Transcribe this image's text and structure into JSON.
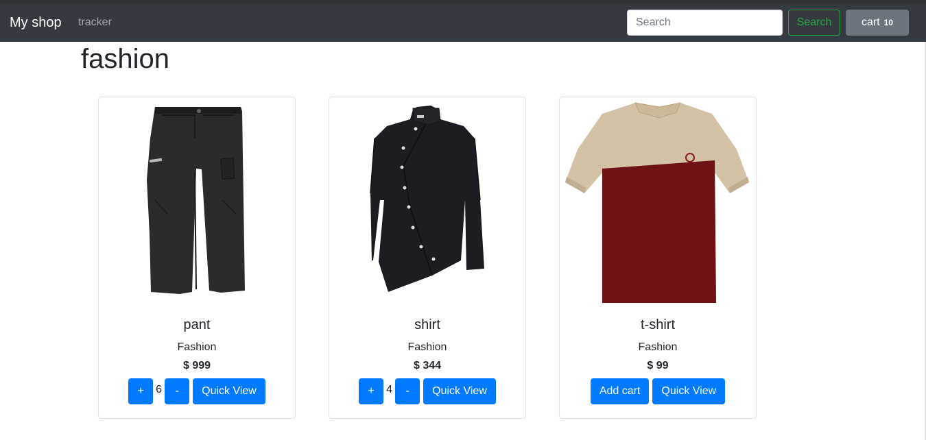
{
  "navbar": {
    "brand": "My shop",
    "link": "tracker",
    "search_placeholder": "Search",
    "search_button": "Search",
    "cart_label": "cart",
    "cart_count": "10"
  },
  "page_title": "fashion",
  "products": [
    {
      "name": "pant",
      "category": "Fashion",
      "price": "$ 999",
      "plus": "+",
      "qty": "6",
      "minus": "-",
      "quick_view": "Quick View",
      "image": "black-pants"
    },
    {
      "name": "shirt",
      "category": "Fashion",
      "price": "$ 344",
      "plus": "+",
      "qty": "4",
      "minus": "-",
      "quick_view": "Quick View",
      "image": "black-shirt"
    },
    {
      "name": "t-shirt",
      "category": "Fashion",
      "price": "$ 99",
      "add_cart": "Add cart",
      "quick_view": "Quick View",
      "image": "beige-maroon-tshirt"
    }
  ],
  "colors": {
    "navbar_bg": "#343a40",
    "primary": "#007bff",
    "success": "#28a745",
    "secondary": "#6c757d"
  }
}
